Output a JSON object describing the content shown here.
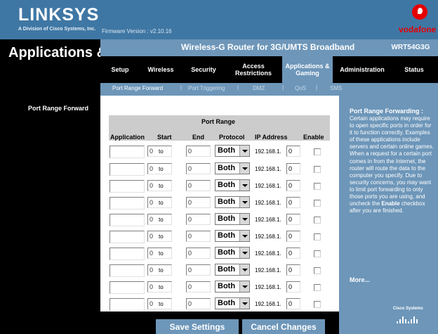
{
  "brand": {
    "logo": "LINKSYS",
    "logo_sub": "A Division of Cisco Systems, Inc.",
    "firmware": "Firmware Version : v2.10.16",
    "partner": "vodafone"
  },
  "header": {
    "section_title": "Applications & Gaming",
    "router_name": "Wireless-G Router for 3G/UMTS Broadband",
    "model": "WRT54G3G"
  },
  "nav": [
    {
      "label": "Setup"
    },
    {
      "label": "Wireless"
    },
    {
      "label": "Security"
    },
    {
      "label": "Access Restrictions"
    },
    {
      "label": "Applications & Gaming"
    },
    {
      "label": "Administration"
    },
    {
      "label": "Status"
    }
  ],
  "subnav": [
    {
      "label": "Port Range Forward"
    },
    {
      "label": "Port Triggering"
    },
    {
      "label": "DMZ"
    },
    {
      "label": "QoS"
    },
    {
      "label": "SMS"
    }
  ],
  "left": {
    "section_label": "Port Range Forward"
  },
  "table": {
    "group_header": "Port Range",
    "columns": [
      "Application",
      "Start",
      "End",
      "Protocol",
      "IP Address",
      "Enable"
    ],
    "to_label": "to",
    "ip_prefix": "192.168.1.",
    "rows": [
      {
        "application": "",
        "start": "0",
        "end": "0",
        "protocol": "Both",
        "ip_last": "0",
        "enabled": false
      },
      {
        "application": "",
        "start": "0",
        "end": "0",
        "protocol": "Both",
        "ip_last": "0",
        "enabled": false
      },
      {
        "application": "",
        "start": "0",
        "end": "0",
        "protocol": "Both",
        "ip_last": "0",
        "enabled": false
      },
      {
        "application": "",
        "start": "0",
        "end": "0",
        "protocol": "Both",
        "ip_last": "0",
        "enabled": false
      },
      {
        "application": "",
        "start": "0",
        "end": "0",
        "protocol": "Both",
        "ip_last": "0",
        "enabled": false
      },
      {
        "application": "",
        "start": "0",
        "end": "0",
        "protocol": "Both",
        "ip_last": "0",
        "enabled": false
      },
      {
        "application": "",
        "start": "0",
        "end": "0",
        "protocol": "Both",
        "ip_last": "0",
        "enabled": false
      },
      {
        "application": "",
        "start": "0",
        "end": "0",
        "protocol": "Both",
        "ip_last": "0",
        "enabled": false
      },
      {
        "application": "",
        "start": "0",
        "end": "0",
        "protocol": "Both",
        "ip_last": "0",
        "enabled": false
      },
      {
        "application": "",
        "start": "0",
        "end": "0",
        "protocol": "Both",
        "ip_last": "0",
        "enabled": false
      }
    ]
  },
  "help": {
    "title": "Port Range Forwarding :",
    "text_before": "Certain applications may require to open specific ports in order for it to function correctly. Examples of these applications include servers and certain online games. When a request for a certain port comes in from the Internet, the router will route the data to the computer you specify. Due to security concerns, you may want to limit port forwarding to only those ports you are using, and uncheck the ",
    "text_bold": "Enable",
    "text_after": " checkbox after you are finished.",
    "more": "More..."
  },
  "footer": {
    "save": "Save Settings",
    "cancel": "Cancel Changes",
    "cisco": "Cisco Systems"
  },
  "colors": {
    "accent": "#6d96b9",
    "banner": "#3f77a4",
    "dark": "#000000",
    "vodafone_red": "#e60000"
  }
}
